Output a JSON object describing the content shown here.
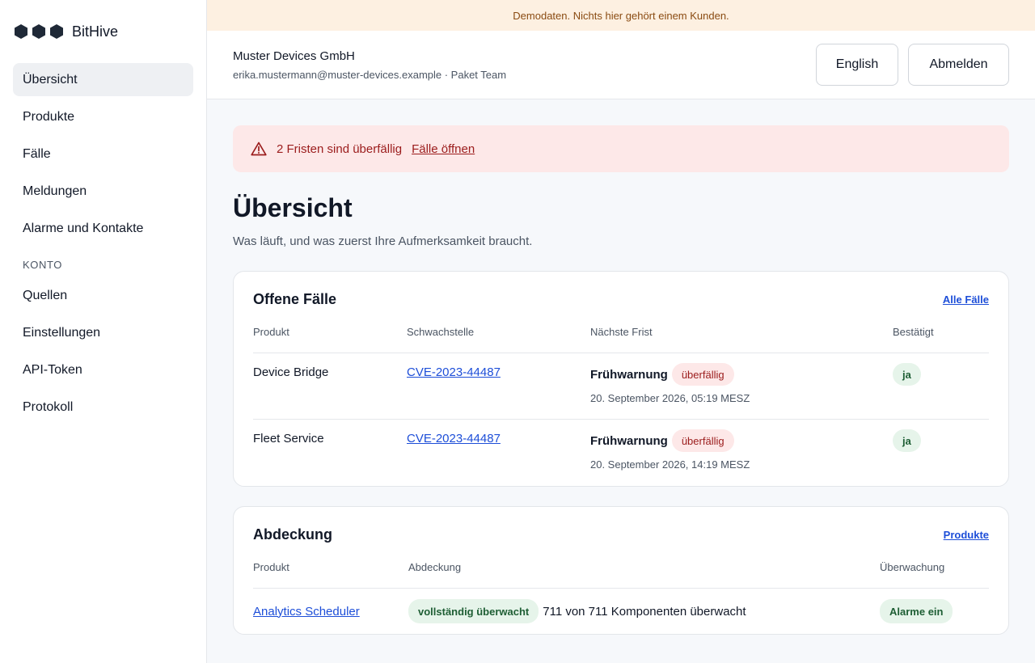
{
  "brand": {
    "name": "BitHive"
  },
  "sidebar": {
    "items": [
      {
        "label": "Übersicht",
        "active": true
      },
      {
        "label": "Produkte"
      },
      {
        "label": "Fälle"
      },
      {
        "label": "Meldungen"
      },
      {
        "label": "Alarme und Kontakte"
      }
    ],
    "section_label": "KONTO",
    "account_items": [
      {
        "label": "Quellen"
      },
      {
        "label": "Einstellungen"
      },
      {
        "label": "API-Token"
      },
      {
        "label": "Protokoll"
      }
    ]
  },
  "banner": {
    "text": "Demodaten. Nichts hier gehört einem Kunden."
  },
  "topbar": {
    "org_name": "Muster Devices GmbH",
    "org_sub": "erika.mustermann@muster-devices.example · Paket Team",
    "lang_button": "English",
    "logout_button": "Abmelden"
  },
  "alert": {
    "text": "2 Fristen sind überfällig",
    "link": "Fälle öffnen"
  },
  "page": {
    "title": "Übersicht",
    "subtitle": "Was läuft, und was zuerst Ihre Aufmerksamkeit braucht."
  },
  "cases": {
    "title": "Offene Fälle",
    "link": "Alle Fälle",
    "headers": [
      "Produkt",
      "Schwachstelle",
      "Nächste Frist",
      "Bestätigt"
    ],
    "rows": [
      {
        "product": "Device Bridge",
        "cve": "CVE-2023-44487",
        "deadline_label": "Frühwarnung",
        "status": "überfällig",
        "date": "20. September 2026, 05:19 MESZ",
        "confirmed": "ja"
      },
      {
        "product": "Fleet Service",
        "cve": "CVE-2023-44487",
        "deadline_label": "Frühwarnung",
        "status": "überfällig",
        "date": "20. September 2026, 14:19 MESZ",
        "confirmed": "ja"
      }
    ]
  },
  "coverage": {
    "title": "Abdeckung",
    "link": "Produkte",
    "headers": [
      "Produkt",
      "Abdeckung",
      "Überwachung"
    ],
    "rows": [
      {
        "product": "Analytics Scheduler",
        "badge": "vollständig überwacht",
        "detail": "711 von 711 Komponenten überwacht",
        "monitoring": "Alarme ein"
      }
    ]
  },
  "colors": {
    "accent_link": "#1d4ed8",
    "danger": "#9b1c1c",
    "success": "#1e5e34",
    "banner_bg": "#fdf0e1"
  }
}
